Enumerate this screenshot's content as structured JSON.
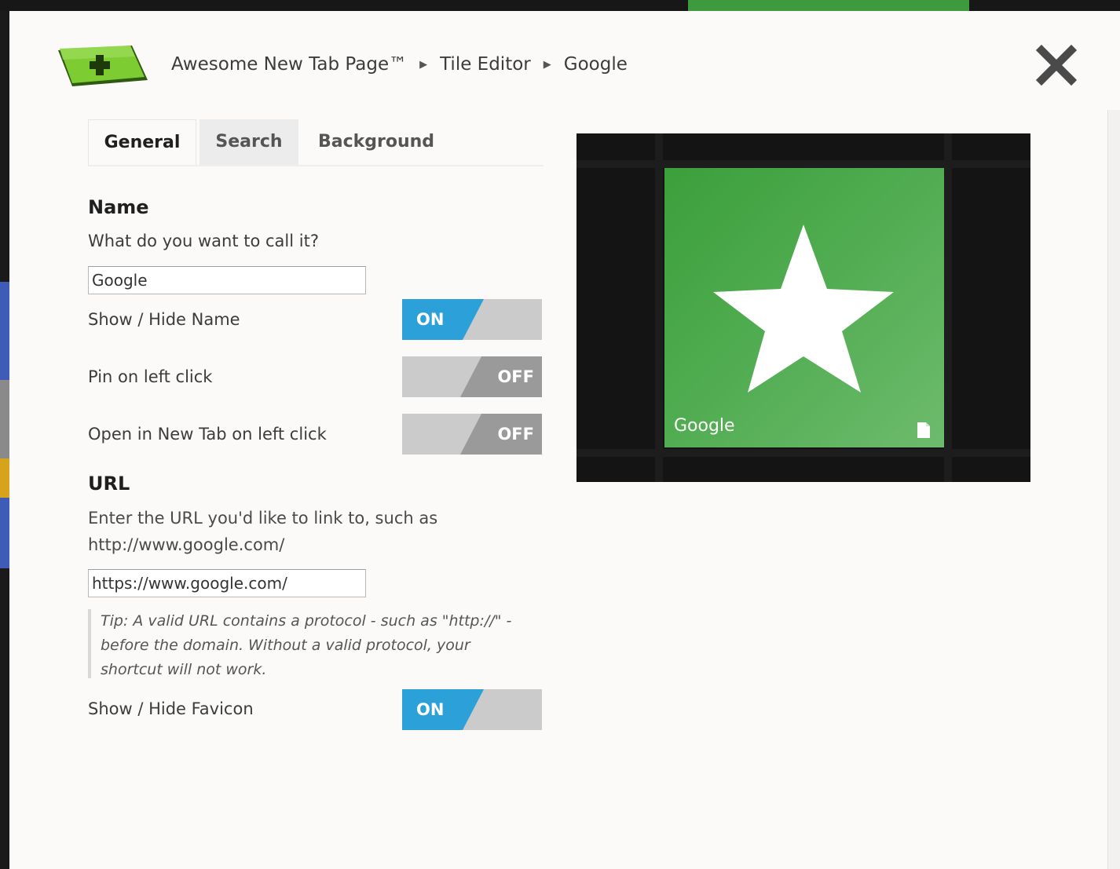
{
  "app": {
    "breadcrumb": [
      "Awesome New Tab Page™",
      "Tile Editor",
      "Google"
    ]
  },
  "tabs": [
    {
      "label": "General",
      "active": true
    },
    {
      "label": "Search",
      "active": false
    },
    {
      "label": "Background",
      "active": false
    }
  ],
  "name_section": {
    "title": "Name",
    "prompt": "What do you want to call it?",
    "value": "Google"
  },
  "toggles": {
    "show_hide_name": {
      "label": "Show / Hide Name",
      "state": "ON"
    },
    "pin_left_click": {
      "label": "Pin on left click",
      "state": "OFF"
    },
    "open_new_tab": {
      "label": "Open in New Tab on left click",
      "state": "OFF"
    },
    "show_hide_favicon": {
      "label": "Show / Hide Favicon",
      "state": "ON"
    }
  },
  "url_section": {
    "title": "URL",
    "prompt_line1": "Enter the URL you'd like to link to, such as",
    "prompt_line2": "http://www.google.com/",
    "value": "https://www.google.com/",
    "tip_line1": "Tip: A valid URL contains a protocol - such as \"http://\" -",
    "tip_line2": "before the domain. Without a valid protocol, your",
    "tip_line3": "shortcut will not work."
  },
  "preview": {
    "tile_name": "Google",
    "icon": "star-icon"
  },
  "colors": {
    "toggle_on": "#2ca0d8",
    "toggle_off": "#9a9a9a",
    "tile_green": "#4caa4c",
    "logo_green": "#6cbf2a"
  }
}
